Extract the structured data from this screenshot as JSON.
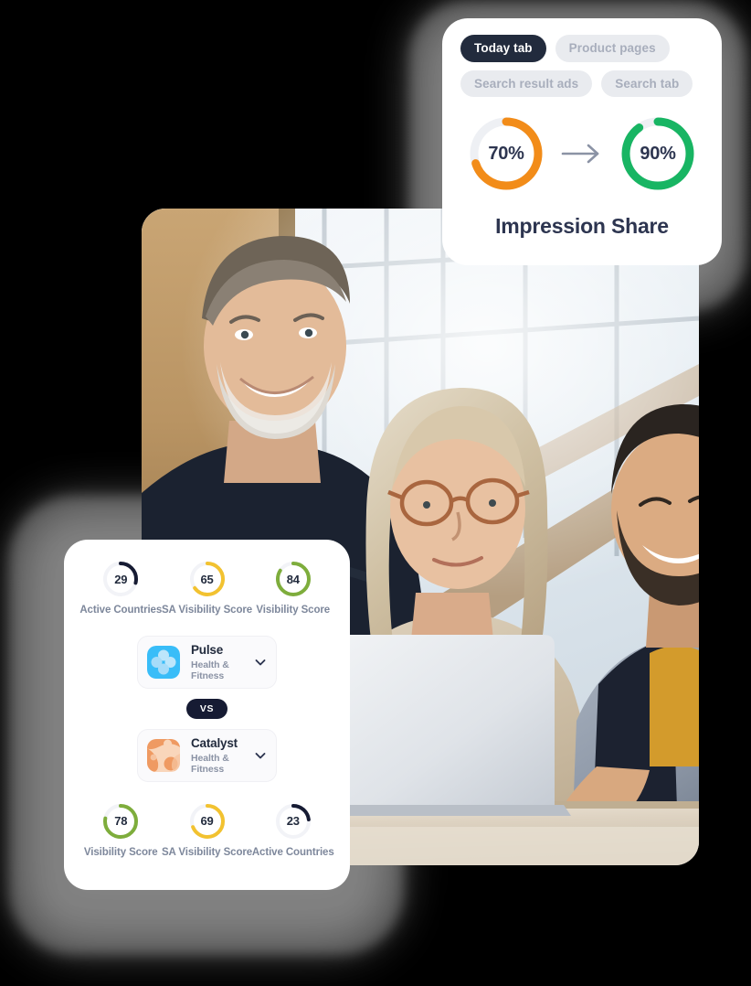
{
  "theme": {
    "background": "#000000",
    "card_bg": "#ffffff",
    "ink": "#2d3550",
    "ink_dark": "#222b3d",
    "muted": "#7d879b",
    "chip_bg": "#e9ebef",
    "chip_text": "#a8aebc",
    "track": "#eef0f4",
    "orange": "#f28c19",
    "green": "#18b563",
    "yellow": "#f2c230",
    "olive": "#7ead3c",
    "navy": "#161b33"
  },
  "impression_card": {
    "tabs": [
      {
        "label": "Today tab",
        "active": true
      },
      {
        "label": "Product pages",
        "active": false
      },
      {
        "label": "Search result ads",
        "active": false
      },
      {
        "label": "Search tab",
        "active": false
      }
    ],
    "title": "Impression Share",
    "arrow_icon": "arrow-right-icon",
    "gauges": [
      {
        "name": "before",
        "value_label": "70%",
        "value": 70,
        "color": "#f28c19"
      },
      {
        "name": "after",
        "value_label": "90%",
        "value": 90,
        "color": "#18b563"
      }
    ]
  },
  "photo_card": {
    "alt": "Three colleagues smiling around a laptop in a bright office"
  },
  "compare_card": {
    "top_scores": [
      {
        "value": "29",
        "pct": 29,
        "label": "Active Countries",
        "color": "#161b33"
      },
      {
        "value": "65",
        "pct": 65,
        "label": "SA Visibility Score",
        "color": "#f2c230"
      },
      {
        "value": "84",
        "pct": 84,
        "label": "Visibility Score",
        "color": "#7ead3c"
      }
    ],
    "app_a": {
      "name": "Pulse",
      "category": "Health & Fitness",
      "icon": "pulse-clover-icon",
      "icon_bg": "#39bdf8",
      "chevron": "chevron-down-icon"
    },
    "vs_label": "VS",
    "app_b": {
      "name": "Catalyst",
      "category": "Health & Fitness",
      "icon": "catalyst-blob-icon",
      "icon_bg": "#f5a06a",
      "chevron": "chevron-down-icon"
    },
    "bottom_scores": [
      {
        "value": "78",
        "pct": 78,
        "label": "Visibility Score",
        "color": "#7ead3c"
      },
      {
        "value": "69",
        "pct": 69,
        "label": "SA Visibility Score",
        "color": "#f2c230"
      },
      {
        "value": "23",
        "pct": 23,
        "label": "Active Countries",
        "color": "#161b33"
      }
    ]
  },
  "chart_data": [
    {
      "type": "pie",
      "title": "Impression Share",
      "subtitle": "before to after",
      "legend": "none",
      "slices": [
        {
          "name": "70%",
          "value": 70,
          "color": "#f28c19"
        },
        {
          "name": "90%",
          "value": 90,
          "color": "#18b563"
        }
      ]
    },
    {
      "type": "pie",
      "title": "Pulse scores",
      "categories": [
        "Active Countries",
        "SA Visibility Score",
        "Visibility Score"
      ],
      "values": [
        29,
        65,
        84
      ],
      "colors": [
        "#161b33",
        "#f2c230",
        "#7ead3c"
      ],
      "ylim": [
        0,
        100
      ]
    },
    {
      "type": "pie",
      "title": "Catalyst scores",
      "categories": [
        "Visibility Score",
        "SA Visibility Score",
        "Active Countries"
      ],
      "values": [
        78,
        69,
        23
      ],
      "colors": [
        "#7ead3c",
        "#f2c230",
        "#161b33"
      ],
      "ylim": [
        0,
        100
      ]
    }
  ]
}
